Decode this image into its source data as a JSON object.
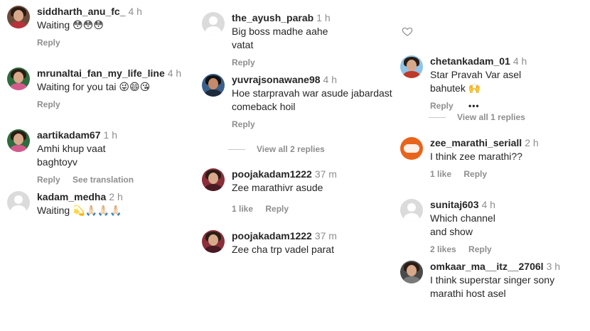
{
  "comments": [
    {
      "username": "siddharth_anu_fc_",
      "time": "4 h",
      "text": "Waiting 😳😳😳",
      "actions": [
        "Reply"
      ]
    },
    {
      "username": "mrunaltai_fan_my_life_line",
      "time": "4 h",
      "text": "Waiting for you tai 😜😄😘",
      "actions": [
        "Reply"
      ]
    },
    {
      "username": "aartikadam67",
      "time": "1 h",
      "text": "Amhi khup vaat baghtoyv",
      "actions": [
        "Reply",
        "See translation"
      ]
    },
    {
      "username": "kadam_medha",
      "time": "2 h",
      "text": "Waiting 💫🙏🏻🙏🏻🙏🏻",
      "actions": []
    },
    {
      "username": "the_ayush_parab",
      "time": "1 h",
      "text": "Big boss madhe aahe vatat",
      "actions": [
        "Reply"
      ]
    },
    {
      "username": "yuvrajsonawane98",
      "time": "4 h",
      "text": "Hoe starpravah war asude jabardast comeback hoil",
      "actions": [
        "Reply"
      ]
    },
    {
      "username": "poojakadam1222",
      "time": "37 m",
      "text": "Zee marathivr asude",
      "actions": [
        "1 like",
        "Reply"
      ]
    },
    {
      "username": "poojakadam1222",
      "time": "37 m",
      "text": "Zee cha trp vadel parat",
      "actions": []
    },
    {
      "username": "chetankadam_01",
      "time": "4 h",
      "text": "Star Pravah Var asel bahutek 🙌",
      "actions": [
        "Reply"
      ]
    },
    {
      "username": "zee_marathi_seriall",
      "time": "2 h",
      "text": "I think zee marathi??",
      "actions": [
        "1 like",
        "Reply"
      ]
    },
    {
      "username": "sunitaj603",
      "time": "4 h",
      "text": "Which channel and show",
      "actions": [
        "2 likes",
        "Reply"
      ]
    },
    {
      "username": "omkaar_ma__itz__2706l",
      "time": "3 h",
      "text": "I think superstar singer sony marathi host asel",
      "actions": []
    }
  ],
  "view_replies": [
    "View all 2 replies",
    "View all 1 replies"
  ],
  "icons": {
    "heart": "heart-icon",
    "more": "more-options-icon"
  }
}
